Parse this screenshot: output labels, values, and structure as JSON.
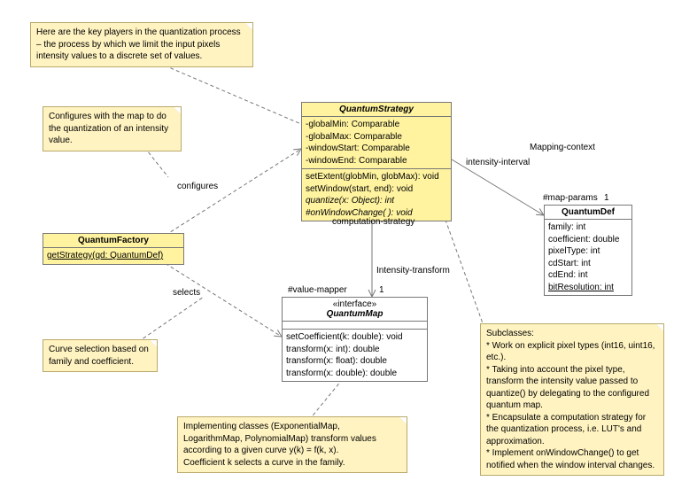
{
  "notes": {
    "intro": "Here are the key players in the quantization process – the process by which we limit the input pixels intensity values to a discrete set of values.",
    "configures": "Configures with the map to do the quantization of an intensity value.",
    "selects": "Curve selection based on family and coefficient.",
    "mapimpl": "Implementing classes (ExponentialMap, LogarithmMap, PolynomialMap) transform values according to a given curve y(k) = f(k, x).\nCoefficient k selects a curve in the family.",
    "subclasses": "Subclasses:\n* Work on explicit pixel types (int16, uint16, etc.).\n* Taking into account the pixel type, transform the intensity value passed to quantize() by delegating to the configured quantum map.\n* Encapsulate a computation strategy for the quantization process, i.e. LUT's and approximation.\n* Implement onWindowChange() to get notified when the window interval changes."
  },
  "classes": {
    "quantumFactory": {
      "name": "QuantumFactory",
      "ops": {
        "getStrategy": "getStrategy(qd: QuantumDef)"
      }
    },
    "quantumStrategy": {
      "name": "QuantumStrategy",
      "attrs": {
        "globalMin": "-globalMin: Comparable",
        "globalMax": "-globalMax: Comparable",
        "windowStart": "-windowStart: Comparable",
        "windowEnd": "-windowEnd: Comparable"
      },
      "ops": {
        "setExtent": "setExtent(globMin, globMax): void",
        "setWindow": "setWindow(start, end): void",
        "quantize": "quantize(x: Object): int",
        "onWindowChange": "#onWindowChange( ): void"
      }
    },
    "quantumMap": {
      "stereo": "«interface»",
      "name": "QuantumMap",
      "ops": {
        "setCoefficient": "setCoefficient(k: double): void",
        "transformInt": "transform(x: int): double",
        "transformFloat": "transform(x: float): double",
        "transformDouble": "transform(x: double): double"
      }
    },
    "quantumDef": {
      "name": "QuantumDef",
      "attrs": {
        "family": "family: int",
        "coefficient": "coefficient: double",
        "pixelType": "pixelType: int",
        "cdStart": "cdStart: int",
        "cdEnd": "cdEnd: int",
        "bitResolution": "bitResolution: int"
      }
    }
  },
  "labels": {
    "configures": "configures",
    "selects": "selects",
    "computationStrategy": "computation-strategy",
    "intensityTransform": "Intensity-transform",
    "valueMapper": "#value-mapper",
    "valueMapperMult": "1",
    "intensityInterval": "intensity-interval",
    "mappingContext": "Mapping-context",
    "mapParams": "#map-params",
    "mapParamsMult": "1"
  }
}
